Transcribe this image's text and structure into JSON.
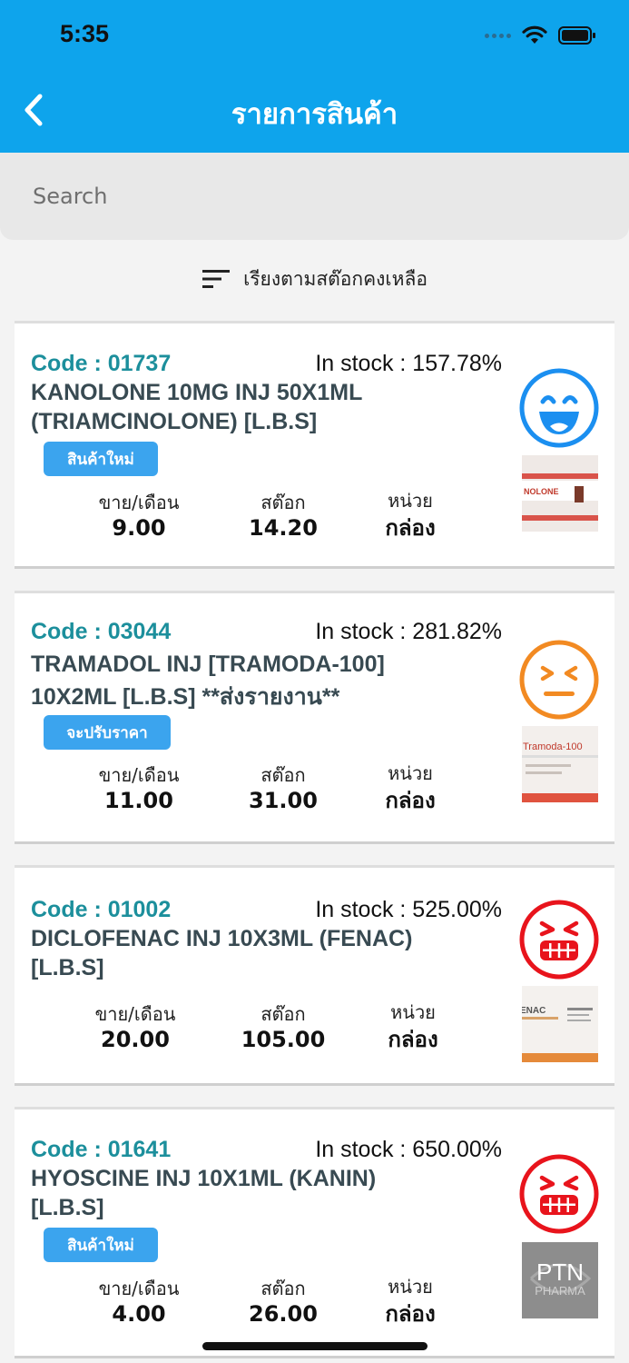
{
  "status_bar": {
    "time": "5:35"
  },
  "header": {
    "title": "รายการสินค้า"
  },
  "search": {
    "placeholder": "Search"
  },
  "sort": {
    "label": "เรียงตามสต๊อกคงเหลือ"
  },
  "columns": {
    "sales_label": "ขาย/เดือน",
    "stock_label": "สต๊อก",
    "unit_label": "หน่วย"
  },
  "products": [
    {
      "code": "Code : 01737",
      "in_stock": "In stock : 157.78%",
      "name_line1": "KANOLONE 10MG INJ 50X1ML",
      "name_line2": "(TRIAMCINOLONE) [L.B.S]",
      "badge": "สินค้าใหม่",
      "sales": "9.00",
      "stock": "14.20",
      "unit": "กล่อง",
      "face_icon": "laughing-face-icon",
      "face_color": "#1b8ff0",
      "thumb_text": "NOLONE"
    },
    {
      "code": "Code : 03044",
      "in_stock": "In stock : 281.82%",
      "name_line1": "TRAMADOL INJ [TRAMODA-100]",
      "name_line2": "10X2ML [L.B.S]  **ส่งรายงาน**",
      "badge": "จะปรับราคา",
      "sales": "11.00",
      "stock": "31.00",
      "unit": "กล่อง",
      "face_icon": "squinting-neutral-face-icon",
      "face_color": "#f28a22",
      "thumb_text": "Tramoda-100"
    },
    {
      "code": "Code : 01002",
      "in_stock": "In stock : 525.00%",
      "name_line1": "DICLOFENAC INJ 10X3ML (FENAC)",
      "name_line2": "[L.B.S]",
      "badge": "",
      "sales": "20.00",
      "stock": "105.00",
      "unit": "กล่อง",
      "face_icon": "angry-grimace-face-icon",
      "face_color": "#e8141c",
      "thumb_text": "ENAC"
    },
    {
      "code": "Code : 01641",
      "in_stock": "In stock : 650.00%",
      "name_line1": "HYOSCINE INJ  10X1ML (KANIN)",
      "name_line2": "[L.B.S]",
      "badge": "สินค้าใหม่",
      "sales": "4.00",
      "stock": "26.00",
      "unit": "กล่อง",
      "face_icon": "angry-grimace-face-icon",
      "face_color": "#e8141c",
      "thumb_text": "PTN",
      "thumb_sub": "PHARMA"
    }
  ]
}
